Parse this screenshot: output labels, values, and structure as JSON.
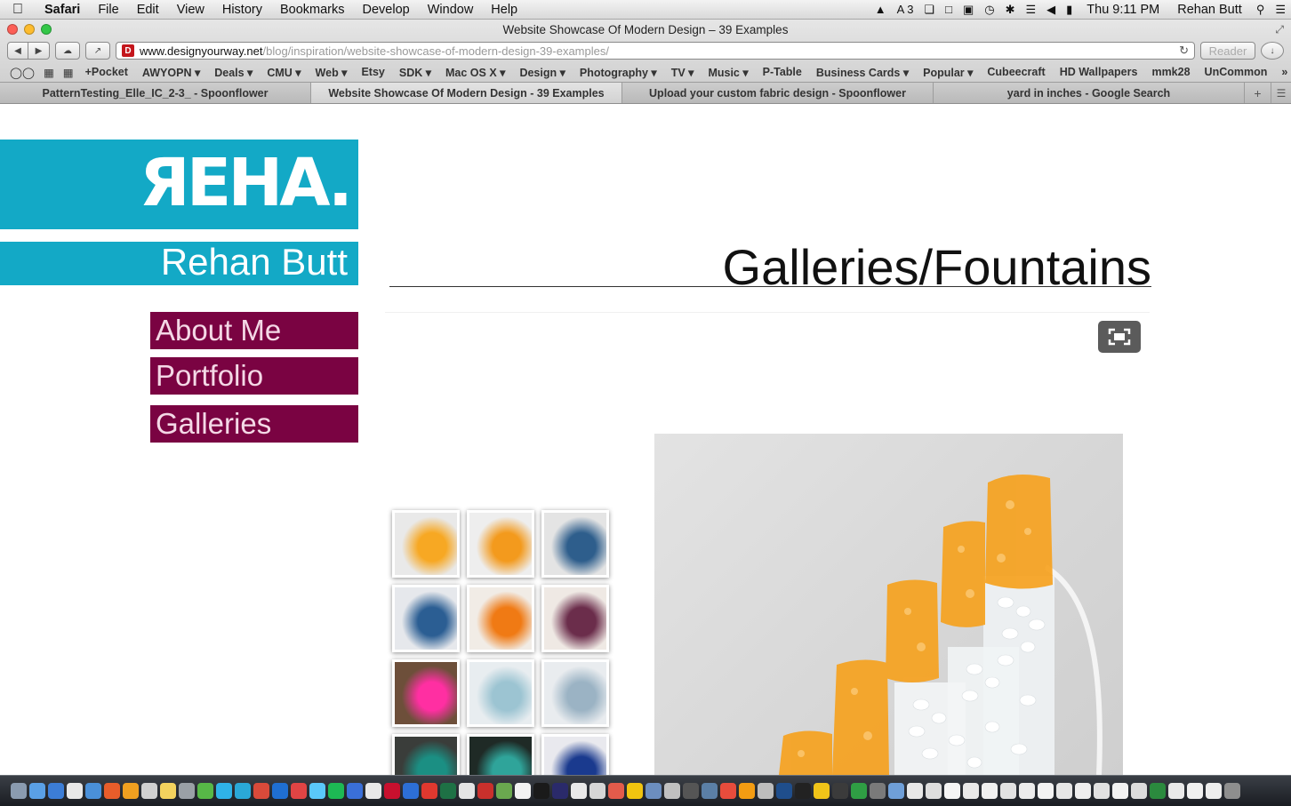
{
  "menubar": {
    "apple": "",
    "items": [
      "Safari",
      "File",
      "Edit",
      "View",
      "History",
      "Bookmarks",
      "Develop",
      "Window",
      "Help"
    ],
    "tray_adobe_count": "3",
    "clock": "Thu 9:11 PM",
    "user": "Rehan Butt"
  },
  "window": {
    "title": "Website Showcase Of Modern Design – 39 Examples"
  },
  "url": {
    "host": "www.designyourway.net",
    "path": "/blog/inspiration/website-showcase-of-modern-design-39-examples/",
    "favicon_letter": "D",
    "reader_label": "Reader"
  },
  "bookmarks": [
    "+Pocket",
    "AWYOPN",
    "Deals",
    "CMU",
    "Web",
    "Etsy",
    "SDK",
    "Mac OS X",
    "Design",
    "Photography",
    "TV",
    "Music",
    "P-Table",
    "Business Cards",
    "Popular",
    "Cubeecraft",
    "HD Wallpapers",
    "mmk28",
    "UnCommon"
  ],
  "bookmark_dropdowns": [
    false,
    true,
    true,
    true,
    true,
    false,
    true,
    true,
    true,
    true,
    true,
    true,
    false,
    true,
    true,
    false,
    false,
    false,
    false
  ],
  "tabs": [
    {
      "label": "PatternTesting_Elle_IC_2-3_ - Spoonflower",
      "active": false
    },
    {
      "label": "Website Showcase Of Modern Design - 39 Examples",
      "active": true
    },
    {
      "label": "Upload your custom fabric design - Spoonflower",
      "active": false
    },
    {
      "label": "yard in inches - Google Search",
      "active": false
    }
  ],
  "site": {
    "logo_text": "ЯEHA.",
    "name": "Rehan Butt",
    "nav": [
      "About Me",
      "Portfolio",
      "Galleries"
    ],
    "page_title": "Galleries/Fountains",
    "colors": {
      "brand_cyan": "#13a9c6",
      "nav_magenta": "#7a0342",
      "nav_text": "#f4d8e6"
    }
  },
  "gallery": {
    "thumbnails": [
      {
        "name": "thumb-orange-steps",
        "colors": [
          "#e9e9e9",
          "#f7a823"
        ]
      },
      {
        "name": "thumb-orange-cascade",
        "colors": [
          "#eeeeee",
          "#f39a1d"
        ]
      },
      {
        "name": "thumb-blue-tiered",
        "colors": [
          "#e4e4e4",
          "#2e5e8c"
        ]
      },
      {
        "name": "thumb-blue-flowers",
        "colors": [
          "#e6e8ec",
          "#2b5e93"
        ]
      },
      {
        "name": "thumb-orange-swing",
        "colors": [
          "#f1ece6",
          "#f07a14"
        ]
      },
      {
        "name": "thumb-purple-swing",
        "colors": [
          "#efe9e4",
          "#6b2d4b"
        ]
      },
      {
        "name": "thumb-neon-tree",
        "colors": [
          "#6d4f3a",
          "#ff2fa2"
        ]
      },
      {
        "name": "thumb-glass-block",
        "colors": [
          "#e8edf0",
          "#9cc4d2"
        ]
      },
      {
        "name": "thumb-white-sculpture",
        "colors": [
          "#e9ecef",
          "#9bb3c4"
        ]
      },
      {
        "name": "thumb-teal-cascade",
        "colors": [
          "#3a3d3a",
          "#1b8f83"
        ]
      },
      {
        "name": "thumb-green-bowls",
        "colors": [
          "#1f2a26",
          "#2fa49a"
        ]
      },
      {
        "name": "thumb-blue-frame",
        "colors": [
          "#e9e9ee",
          "#1a3a8e"
        ]
      }
    ],
    "main_image": "orange-glass-fountain-steps"
  },
  "dock": {
    "icon_count": 66
  }
}
